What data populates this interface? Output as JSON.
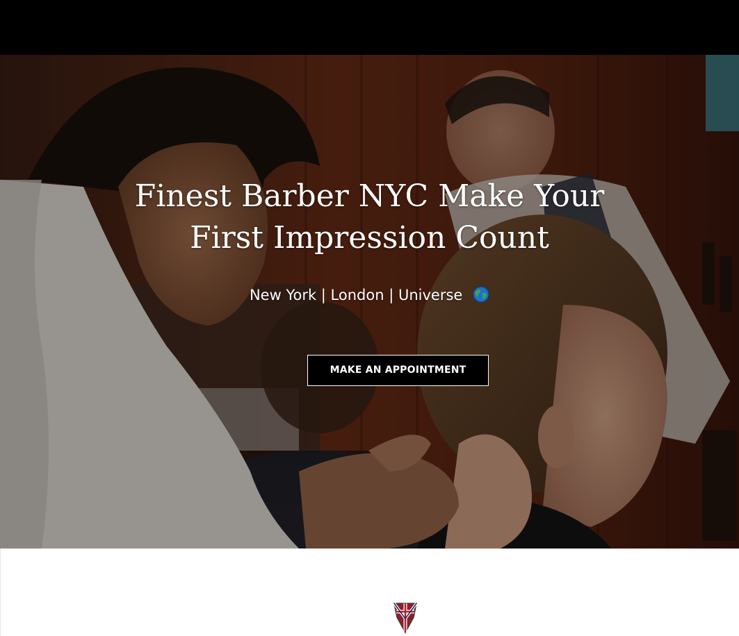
{
  "hero": {
    "title": "Finest Barber NYC Make Your First Impression Count",
    "subtitle": "New York | London | Universe",
    "subtitle_icon": "globe-icon",
    "cta_label": "MAKE AN APPOINTMENT"
  },
  "colors": {
    "top_bar": "#000000",
    "button_bg": "#000000",
    "button_border": "#ffffff",
    "text": "#ffffff",
    "section_bg": "#ffffff"
  },
  "lower_section": {
    "emblem_icon": "union-jack-shield-icon"
  }
}
